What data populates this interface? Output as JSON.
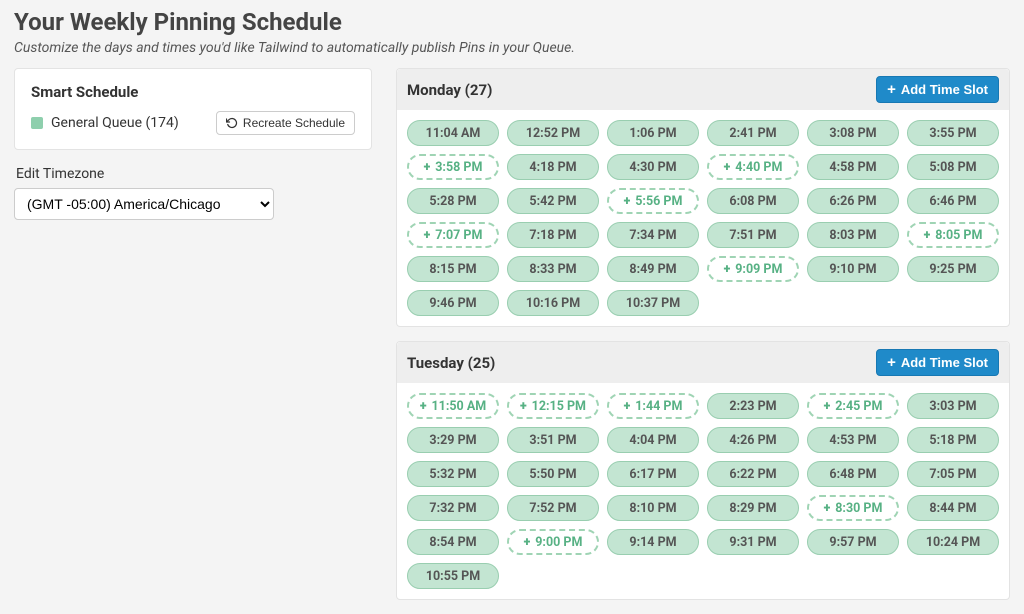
{
  "page": {
    "title": "Your Weekly Pinning Schedule",
    "subtitle": "Customize the days and times you'd like Tailwind to automatically publish Pins in your Queue."
  },
  "sidebar": {
    "smart_schedule_title": "Smart Schedule",
    "queue_label": "General Queue (174)",
    "recreate_label": "Recreate Schedule",
    "tz_section_label": "Edit Timezone",
    "tz_selected": "(GMT -05:00) America/Chicago"
  },
  "add_button_label": "Add Time Slot",
  "days": [
    {
      "name": "Monday",
      "count": 27,
      "slots": [
        {
          "t": "11:04 AM",
          "s": false
        },
        {
          "t": "12:52 PM",
          "s": false
        },
        {
          "t": "1:06 PM",
          "s": false
        },
        {
          "t": "2:41 PM",
          "s": false
        },
        {
          "t": "3:08 PM",
          "s": false
        },
        {
          "t": "3:55 PM",
          "s": false
        },
        {
          "t": "3:58 PM",
          "s": true
        },
        {
          "t": "4:18 PM",
          "s": false
        },
        {
          "t": "4:30 PM",
          "s": false
        },
        {
          "t": "4:40 PM",
          "s": true
        },
        {
          "t": "4:58 PM",
          "s": false
        },
        {
          "t": "5:08 PM",
          "s": false
        },
        {
          "t": "5:28 PM",
          "s": false
        },
        {
          "t": "5:42 PM",
          "s": false
        },
        {
          "t": "5:56 PM",
          "s": true
        },
        {
          "t": "6:08 PM",
          "s": false
        },
        {
          "t": "6:26 PM",
          "s": false
        },
        {
          "t": "6:46 PM",
          "s": false
        },
        {
          "t": "7:07 PM",
          "s": true
        },
        {
          "t": "7:18 PM",
          "s": false
        },
        {
          "t": "7:34 PM",
          "s": false
        },
        {
          "t": "7:51 PM",
          "s": false
        },
        {
          "t": "8:03 PM",
          "s": false
        },
        {
          "t": "8:05 PM",
          "s": true
        },
        {
          "t": "8:15 PM",
          "s": false
        },
        {
          "t": "8:33 PM",
          "s": false
        },
        {
          "t": "8:49 PM",
          "s": false
        },
        {
          "t": "9:09 PM",
          "s": true
        },
        {
          "t": "9:10 PM",
          "s": false
        },
        {
          "t": "9:25 PM",
          "s": false
        },
        {
          "t": "9:46 PM",
          "s": false
        },
        {
          "t": "10:16 PM",
          "s": false
        },
        {
          "t": "10:37 PM",
          "s": false
        }
      ]
    },
    {
      "name": "Tuesday",
      "count": 25,
      "slots": [
        {
          "t": "11:50 AM",
          "s": true
        },
        {
          "t": "12:15 PM",
          "s": true
        },
        {
          "t": "1:44 PM",
          "s": true
        },
        {
          "t": "2:23 PM",
          "s": false
        },
        {
          "t": "2:45 PM",
          "s": true
        },
        {
          "t": "3:03 PM",
          "s": false
        },
        {
          "t": "3:29 PM",
          "s": false
        },
        {
          "t": "3:51 PM",
          "s": false
        },
        {
          "t": "4:04 PM",
          "s": false
        },
        {
          "t": "4:26 PM",
          "s": false
        },
        {
          "t": "4:53 PM",
          "s": false
        },
        {
          "t": "5:18 PM",
          "s": false
        },
        {
          "t": "5:32 PM",
          "s": false
        },
        {
          "t": "5:50 PM",
          "s": false
        },
        {
          "t": "6:17 PM",
          "s": false
        },
        {
          "t": "6:22 PM",
          "s": false
        },
        {
          "t": "6:48 PM",
          "s": false
        },
        {
          "t": "7:05 PM",
          "s": false
        },
        {
          "t": "7:32 PM",
          "s": false
        },
        {
          "t": "7:52 PM",
          "s": false
        },
        {
          "t": "8:10 PM",
          "s": false
        },
        {
          "t": "8:29 PM",
          "s": false
        },
        {
          "t": "8:30 PM",
          "s": true
        },
        {
          "t": "8:44 PM",
          "s": false
        },
        {
          "t": "8:54 PM",
          "s": false
        },
        {
          "t": "9:00 PM",
          "s": true
        },
        {
          "t": "9:14 PM",
          "s": false
        },
        {
          "t": "9:31 PM",
          "s": false
        },
        {
          "t": "9:57 PM",
          "s": false
        },
        {
          "t": "10:24 PM",
          "s": false
        },
        {
          "t": "10:55 PM",
          "s": false
        }
      ]
    }
  ]
}
